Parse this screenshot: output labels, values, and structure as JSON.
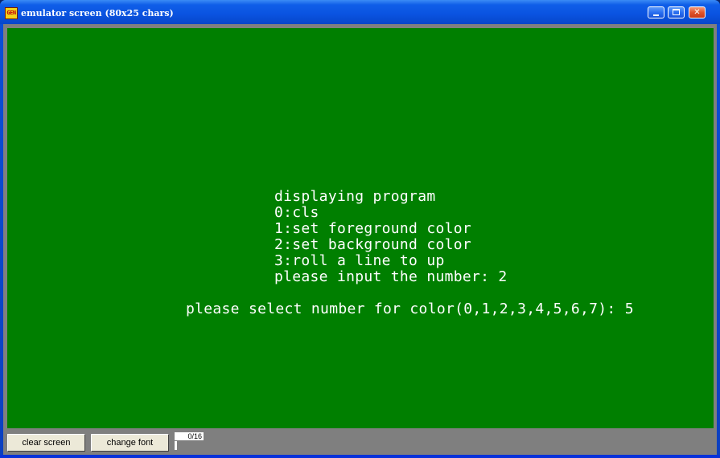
{
  "window": {
    "title": "emulator screen (80x25 chars)",
    "icon_text": "GEN",
    "buttons": {
      "minimize": "minimize-icon",
      "maximize": "maximize-icon",
      "close": "close-icon",
      "close_glyph": "✕"
    }
  },
  "screen": {
    "background": "#007f00",
    "foreground": "#ffffff",
    "lines": [
      "displaying program",
      "0:cls",
      "1:set foreground color",
      "2:set background color",
      "3:roll a line to up",
      "please input the number: 2",
      "please select number for color(0,1,2,3,4,5,6,7): 5"
    ]
  },
  "toolbar": {
    "clear_label": "clear screen",
    "font_label": "change font",
    "progress_text": "0/16",
    "progress_value": 0
  }
}
